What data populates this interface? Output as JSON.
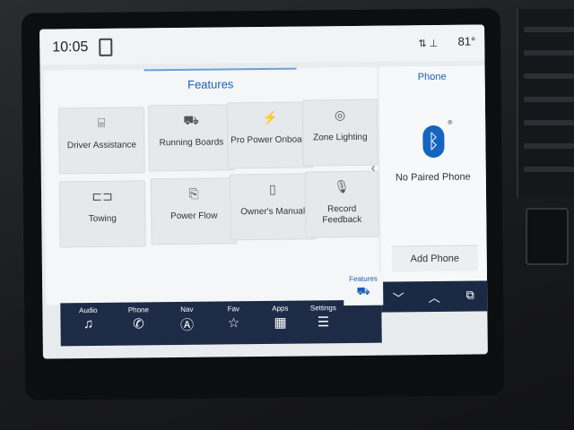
{
  "status_bar": {
    "time": "10:05",
    "signal_symbol": "⇅ ⊥",
    "temperature": "81°"
  },
  "features": {
    "title": "Features",
    "tiles": [
      {
        "label": "Driver Assistance",
        "icon": "driver-assistance-icon",
        "glyph": "⌸"
      },
      {
        "label": "Running Boards",
        "icon": "running-boards-icon",
        "glyph": "⛟"
      },
      {
        "label": "Pro Power Onboard",
        "icon": "pro-power-icon",
        "glyph": "⚡"
      },
      {
        "label": "Zone Lighting",
        "icon": "zone-lighting-icon",
        "glyph": "◎"
      },
      {
        "label": "Towing",
        "icon": "towing-icon",
        "glyph": "⊏⊐"
      },
      {
        "label": "Power Flow",
        "icon": "power-flow-icon",
        "glyph": "⎘"
      },
      {
        "label": "Owner's Manual",
        "icon": "owners-manual-icon",
        "glyph": "▯"
      },
      {
        "label": "Record Feedback",
        "icon": "microphone-icon",
        "glyph": "🎙"
      }
    ]
  },
  "phone_panel": {
    "title": "Phone",
    "status": "No Paired Phone",
    "add_phone": "Add Phone",
    "bluetooth_glyph": "ᛒ",
    "registered_mark": "®",
    "controls": [
      "﹀",
      "︿",
      "⧉"
    ]
  },
  "nav_bar": {
    "items": [
      {
        "label": "Audio",
        "icon": "music-note-icon",
        "glyph": "♫"
      },
      {
        "label": "Phone",
        "icon": "phone-icon",
        "glyph": "✆"
      },
      {
        "label": "Nav",
        "icon": "navigation-icon",
        "glyph": "Ⓐ"
      },
      {
        "label": "Fav",
        "icon": "star-icon",
        "glyph": "☆"
      },
      {
        "label": "Apps",
        "icon": "apps-grid-icon",
        "glyph": "▦"
      },
      {
        "label": "Settings",
        "icon": "sliders-icon",
        "glyph": "☰"
      }
    ],
    "active": {
      "label": "Features",
      "icon": "vehicle-icon",
      "glyph": "⛟"
    }
  },
  "colors": {
    "accent": "#1a5fb4",
    "nav_background": "#1d2b47",
    "bluetooth": "#1565c0"
  }
}
